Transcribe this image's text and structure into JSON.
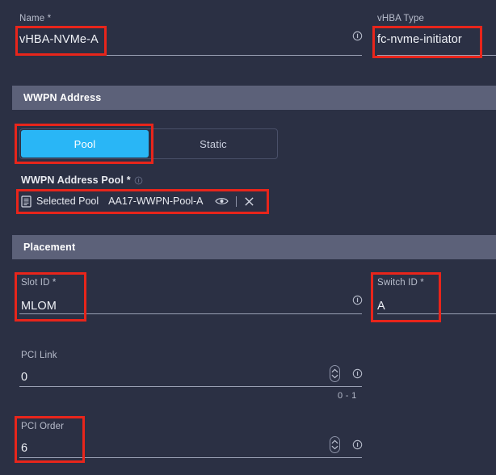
{
  "form": {
    "fields": {
      "name": {
        "label": "Name *",
        "value": "vHBA-NVMe-A",
        "info_icon": "info-icon"
      },
      "vhba_type": {
        "label": "vHBA Type",
        "value": "fc-nvme-initiator"
      },
      "slot_id": {
        "label": "Slot ID *",
        "value": "MLOM",
        "info_icon": "info-icon"
      },
      "switch_id": {
        "label": "Switch ID *",
        "value": "A"
      },
      "pci_link": {
        "label": "PCI Link",
        "value": "0",
        "range_hint": "0 - 1",
        "info_icon": "info-icon",
        "spinner_icon": "stepper-icon"
      },
      "pci_order": {
        "label": "PCI Order",
        "value": "6",
        "info_icon": "info-icon",
        "spinner_icon": "stepper-icon"
      }
    }
  },
  "sections": {
    "wwpn_address": {
      "title": "WWPN Address",
      "toggle": {
        "options": [
          "Pool",
          "Static"
        ],
        "selected": "Pool"
      },
      "pool_field": {
        "label": "WWPN Address Pool *",
        "selected_label": "Selected Pool",
        "selected_value": "AA17-WWPN-Pool-A",
        "doc_icon": "document-icon",
        "preview_icon": "eye-icon",
        "clear_icon": "close-icon"
      }
    },
    "placement": {
      "title": "Placement"
    }
  },
  "colors": {
    "background": "#2b3044",
    "section_bar": "#5c6179",
    "accent_blue": "#29b6f6",
    "annotation_red": "#e8251b",
    "label_text": "#b8bdcc",
    "value_text": "#f0f2f7"
  }
}
